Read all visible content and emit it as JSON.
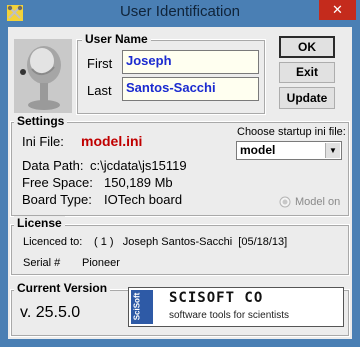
{
  "window": {
    "title": "User Identification",
    "close_glyph": "✕"
  },
  "user_name": {
    "group_label": "User Name",
    "first_label": "First",
    "first_value": "Joseph",
    "last_label": "Last",
    "last_value": "Santos-Sacchi"
  },
  "buttons": {
    "ok": "OK",
    "exit": "Exit",
    "update": "Update"
  },
  "settings": {
    "group_label": "Settings",
    "ini_file_label": "Ini File:",
    "ini_file_value": "model.ini",
    "startup_label": "Choose startup ini file:",
    "startup_selected": "model",
    "data_path_label": "Data Path:",
    "data_path_value": "c:\\jcdata\\js15119",
    "free_space_label": "Free Space:",
    "free_space_value": "150,189 Mb",
    "board_type_label": "Board Type:",
    "board_type_value": "IOTech board",
    "model_on_label": "Model on"
  },
  "license": {
    "group_label": "License",
    "licenced_to_label": "Licenced to:",
    "licenced_to_value": "( 1 )   Joseph Santos-Sacchi  [05/18/13]",
    "serial_label": "Serial #",
    "serial_value": "Pioneer"
  },
  "version": {
    "group_label": "Current Version",
    "value": "v. 25.5.0"
  },
  "banner": {
    "side_text": "SciSoft",
    "title": "SCISOFT CO",
    "tagline": "software tools for scientists"
  },
  "colors": {
    "accent_blue": "#1b2bd0",
    "ini_red": "#c00000",
    "titlebar": "#4a7fb4"
  }
}
